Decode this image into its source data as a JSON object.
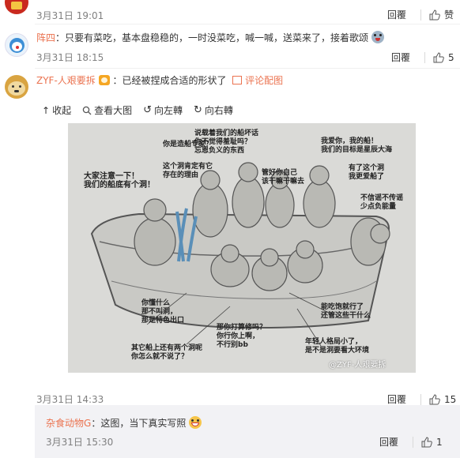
{
  "comments": [
    {
      "timestamp": "3月31日 19:01",
      "reply_label": "回覆",
      "like_label": "赞"
    },
    {
      "username": "阵四",
      "text": "：只要有菜吃，基本盘稳稳的，一时没菜吃，喊一喊，送菜来了，接着歌颂",
      "emoji": "emoji-face",
      "timestamp": "3月31日 18:15",
      "reply_label": "回覆",
      "like_count": "5"
    },
    {
      "username": "ZYF-人艰要拆",
      "text": "：已经被捏成合适的形状了",
      "image_link": "评论配图",
      "toolbar": {
        "collapse": "收起",
        "view_large": "查看大图",
        "rotate_left": "向左轉",
        "rotate_right": "向右轉"
      },
      "image": {
        "captions": [
          "说载着我们的船坏话\n你不觉得羞耻吗？\n忘恩负义的东西",
          "你是造船专家？",
          "我爱你，我的船！\n我们的目标是星辰大海",
          "大家注意一下！\n我们的船底有个洞！",
          "这个洞肯定有它\n存在的理由",
          "管好你自己\n该干嘛干嘛去",
          "有了这个洞\n我更爱船了",
          "不信谣不传谣\n少点负能量",
          "你懂什么\n那不叫洞，\n那是特色出口",
          "能吃饱就行了\n还管这些干什么",
          "那你打算修吗？\n你行你上啊，\n不行别bb",
          "其它船上还有两个洞呢\n你怎么就不说了？",
          "年轻人格局小了，\n是不是洞要看大环境"
        ],
        "watermark": "@ZYF-人艰要拆"
      },
      "timestamp": "3月31日 14:33",
      "reply_label": "回覆",
      "like_count": "15"
    }
  ],
  "sub_comment": {
    "username": "杂食动物G",
    "text": "：这图，当下真实写照",
    "timestamp": "3月31日 15:30",
    "reply_label": "回覆",
    "like_count": "1"
  },
  "colors": {
    "link": "#eb7350",
    "muted": "#808080",
    "sub_bg": "#f2f2f5"
  }
}
